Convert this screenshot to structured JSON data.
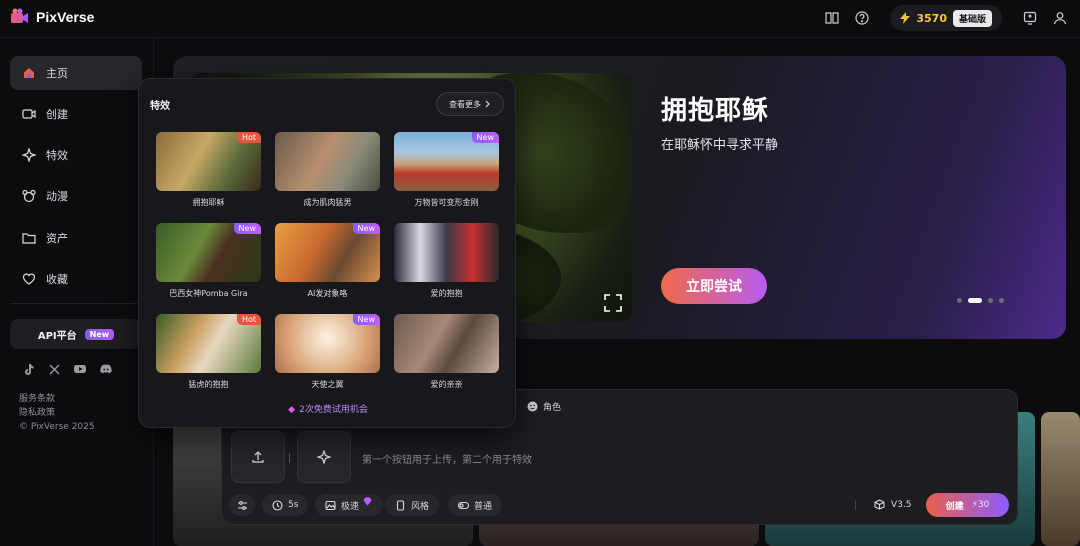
{
  "app": {
    "name": "PixVerse"
  },
  "topbar": {
    "credits": "3570",
    "plan": "基础版"
  },
  "sidebar": {
    "items": [
      {
        "label": "主页",
        "icon": "home-icon"
      },
      {
        "label": "创建",
        "icon": "video-icon"
      },
      {
        "label": "特效",
        "icon": "sparkle-icon"
      },
      {
        "label": "动漫",
        "icon": "mascot-icon"
      },
      {
        "label": "资产",
        "icon": "folder-icon"
      },
      {
        "label": "收藏",
        "icon": "heart-icon"
      }
    ],
    "api": {
      "label": "API平台",
      "badge": "New"
    },
    "socials": [
      "tiktok-icon",
      "x-icon",
      "youtube-icon",
      "discord-icon"
    ],
    "links": [
      "服务条款",
      "隐私政策",
      "© PixVerse 2025"
    ]
  },
  "hero": {
    "title": "拥抱耶稣",
    "subtitle": "在耶稣怀中寻求平静",
    "cta": "立即尝试"
  },
  "effects": {
    "title": "特效",
    "see_more": "查看更多",
    "trial": "2次免费试用机会",
    "cards": [
      {
        "caption": "拥抱耶稣",
        "tag": "Hot"
      },
      {
        "caption": "成为肌肉猛男",
        "tag": ""
      },
      {
        "caption": "万物皆可变形金刚",
        "tag": "New"
      },
      {
        "caption": "巴西女神Pomba Gira",
        "tag": "New"
      },
      {
        "caption": "AI发对象咯",
        "tag": "New"
      },
      {
        "caption": "爱的抱抱",
        "tag": ""
      },
      {
        "caption": "猛虎的抱抱",
        "tag": "Hot"
      },
      {
        "caption": "天使之翼",
        "tag": "New"
      },
      {
        "caption": "爱的亲亲",
        "tag": ""
      }
    ]
  },
  "composer": {
    "role_tab": "角色",
    "placeholder": "第一个按钮用于上传，第二个用于特效",
    "chips": {
      "duration": "5s",
      "speed": "极速",
      "style": "风格",
      "mode": "普通"
    },
    "model": "V3.5",
    "create": "创建",
    "cost": "30"
  },
  "colors": {
    "accent_start": "#ef6a4a",
    "accent_end": "#8c5cff",
    "hot": "#e8553d",
    "credits": "#f5c542"
  }
}
